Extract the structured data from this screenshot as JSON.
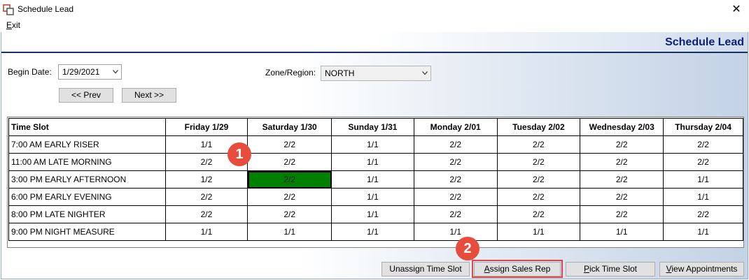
{
  "window": {
    "title": "Schedule Lead",
    "close_glyph": "✕",
    "icon": "app-window-icon"
  },
  "menu": {
    "exit_prefix": "E",
    "exit_rest": "xit"
  },
  "header": {
    "title": "Schedule Lead"
  },
  "filters": {
    "begin_date_label": "Begin Date:",
    "begin_date_value": "1/29/2021",
    "zone_label": "Zone/Region:",
    "zone_value": "NORTH"
  },
  "nav": {
    "prev_label": "<< Prev",
    "next_label": "Next >>"
  },
  "grid": {
    "columns": [
      "Time Slot",
      "Friday 1/29",
      "Saturday 1/30",
      "Sunday 1/31",
      "Monday 2/01",
      "Tuesday 2/02",
      "Wednesday 2/03",
      "Thursday 2/04"
    ],
    "rows": [
      [
        "7:00 AM EARLY RISER",
        "1/1",
        "2/2",
        "1/1",
        "2/2",
        "2/2",
        "2/2",
        "2/2"
      ],
      [
        "11:00 AM LATE MORNING",
        "2/2",
        "2/2",
        "1/1",
        "2/2",
        "2/2",
        "2/2",
        "2/2"
      ],
      [
        "3:00 PM EARLY AFTERNOON",
        "1/2",
        "2/2",
        "1/1",
        "2/2",
        "2/2",
        "2/2",
        "1/1"
      ],
      [
        "6:00 PM EARLY EVENING",
        "2/2",
        "2/2",
        "1/1",
        "2/2",
        "2/2",
        "2/2",
        "1/1"
      ],
      [
        "8:00 PM LATE NIGHTER",
        "2/2",
        "2/2",
        "1/1",
        "2/2",
        "2/2",
        "2/2",
        "2/2"
      ],
      [
        "9:00 PM NIGHT MEASURE",
        "1/1",
        "1/1",
        "1/1",
        "1/1",
        "1/1",
        "1/1",
        "1/1"
      ]
    ],
    "selected_color": "#008000"
  },
  "actions": {
    "unassign_label": "Unassign Time Slot",
    "assign_prefix": "A",
    "assign_rest": "ssign Sales Rep",
    "pick_prefix": "P",
    "pick_rest": "ick Time Slot",
    "view_prefix": "V",
    "view_rest": "iew Appointments"
  },
  "callouts": {
    "one": "1",
    "two": "2",
    "color": "#e74c3c"
  }
}
